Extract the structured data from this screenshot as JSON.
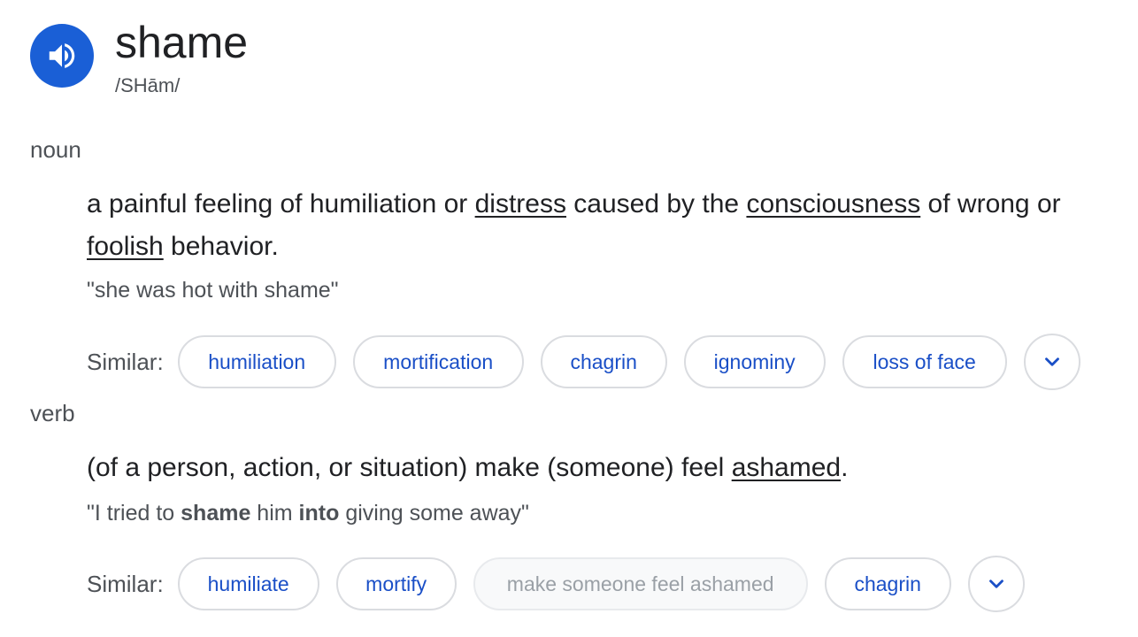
{
  "entry": {
    "word": "shame",
    "phonetic": "/SHām/",
    "speaker_icon": "volume-up-icon"
  },
  "noun": {
    "label": "noun",
    "definition_parts": [
      "a painful feeling of humiliation or ",
      "distress",
      " caused by the ",
      "consciousness",
      " of wrong or ",
      "foolish",
      " behavior."
    ],
    "example": "\"she was hot with shame\"",
    "similar_label": "Similar:",
    "similar": [
      "humiliation",
      "mortification",
      "chagrin",
      "ignominy",
      "loss of face"
    ],
    "expand_icon": "chevron-down-icon"
  },
  "verb": {
    "label": "verb",
    "definition_parts": [
      "(of a person, action, or situation) make (someone) feel ",
      "ashamed",
      "."
    ],
    "example_parts": [
      "\"I tried to ",
      "shame",
      " him ",
      "into",
      " giving some away\""
    ],
    "similar_label": "Similar:",
    "similar": [
      "humiliate",
      "mortify",
      "make someone feel ashamed",
      "chagrin"
    ],
    "expand_icon": "chevron-down-icon"
  },
  "colors": {
    "speaker_bg": "#1a5fd6",
    "chip_text": "#1a4fc7",
    "muted_text": "#4d5156"
  }
}
